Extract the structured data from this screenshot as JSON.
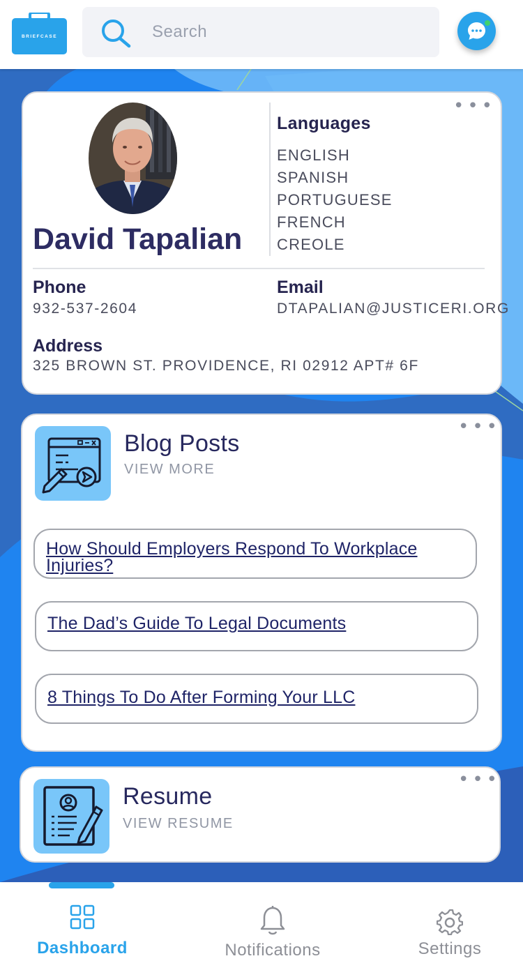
{
  "header": {
    "logo_text": "BRIEFCASE",
    "search_placeholder": "Search"
  },
  "profile": {
    "name": "David Tapalian",
    "languages_title": "Languages",
    "languages": [
      "ENGLISH",
      "SPANISH",
      "PORTUGUESE",
      "FRENCH",
      "CREOLE"
    ],
    "phone_label": "Phone",
    "phone": "932-537-2604",
    "email_label": "Email",
    "email": "DTAPALIAN@JUSTICERI.ORG",
    "address_label": "Address",
    "address": "325 BROWN ST. PROVIDENCE, RI 02912 APT# 6F"
  },
  "blog": {
    "title": "Blog Posts",
    "view_more": "VIEW MORE",
    "posts": [
      "How Should Employers Respond To Workplace Injuries?",
      "The Dad’s Guide To Legal Documents",
      "8 Things To Do After Forming Your LLC"
    ]
  },
  "resume": {
    "title": "Resume",
    "view_resume": "VIEW RESUME"
  },
  "nav": {
    "dashboard": "Dashboard",
    "notifications": "Notifications",
    "settings": "Settings"
  },
  "colors": {
    "accent": "#29a3ea",
    "background": "#2f6cc2",
    "title_text": "#2d2c62",
    "icon_tile": "#79c6f9"
  }
}
